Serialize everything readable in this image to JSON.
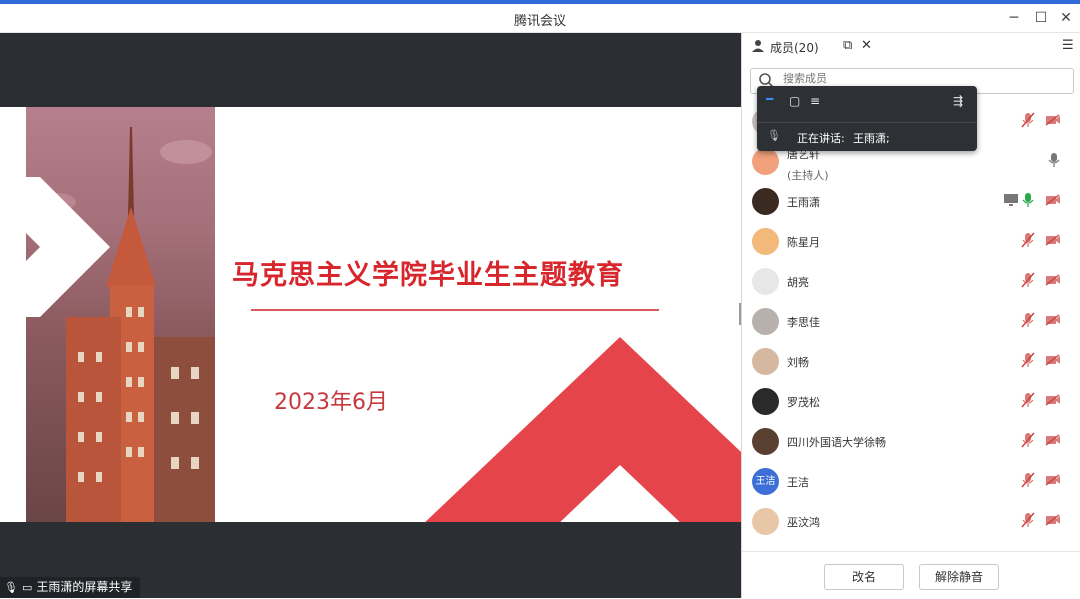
{
  "window": {
    "title": "腾讯会议"
  },
  "slide": {
    "title": "马克思主义学院毕业生主题教育",
    "date": "2023年6月"
  },
  "share_status": {
    "label": "王雨潇的屏幕共享"
  },
  "panel": {
    "title": "成员(20)",
    "search_placeholder": "搜索成员",
    "speaking_label": "正在讲话:",
    "speaking_name": "王雨潇;",
    "footer": {
      "rename": "改名",
      "unmute": "解除静音"
    }
  },
  "members": [
    {
      "name": "",
      "sub": "",
      "avatar": "#c9c3bf",
      "mic": "muted",
      "cam": "off"
    },
    {
      "name": "唐艺轩",
      "sub": "(主持人)",
      "avatar": "#f0a07a",
      "mic": "on",
      "cam": "none"
    },
    {
      "name": "王雨潇",
      "sub": "",
      "avatar": "#3a2a22",
      "mic": "active",
      "cam": "off",
      "screen": true
    },
    {
      "name": "陈星月",
      "sub": "",
      "avatar": "#f2b97a",
      "mic": "muted",
      "cam": "off"
    },
    {
      "name": "胡亮",
      "sub": "",
      "avatar": "#e7e7e7",
      "mic": "muted",
      "cam": "off"
    },
    {
      "name": "李思佳",
      "sub": "",
      "avatar": "#b8b0ac",
      "mic": "muted",
      "cam": "off"
    },
    {
      "name": "刘畅",
      "sub": "",
      "avatar": "#d6b8a0",
      "mic": "muted",
      "cam": "off"
    },
    {
      "name": "罗茂松",
      "sub": "",
      "avatar": "#2a2a2a",
      "mic": "muted",
      "cam": "off"
    },
    {
      "name": "四川外国语大学徐畅",
      "sub": "",
      "avatar": "#5a4030",
      "mic": "muted",
      "cam": "off"
    },
    {
      "name": "王洁",
      "sub": "",
      "avatar": "#3d6fd6",
      "avatar_text": "王洁",
      "mic": "muted",
      "cam": "off"
    },
    {
      "name": "巫汶鸿",
      "sub": "",
      "avatar": "#e8c6a8",
      "mic": "muted",
      "cam": "off"
    }
  ],
  "colors": {
    "accent": "#2f6bd9",
    "slide_red": "#d7272d",
    "muted_red": "#d34a4a",
    "mic_green": "#2ba84a"
  }
}
